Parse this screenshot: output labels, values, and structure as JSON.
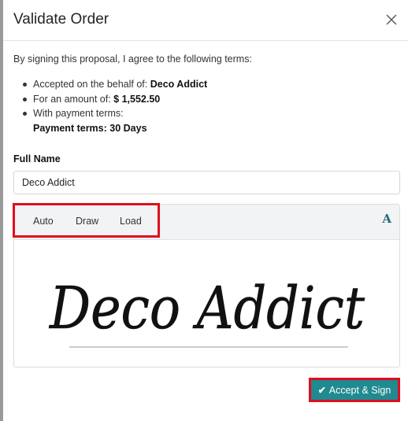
{
  "dialog": {
    "title": "Validate Order",
    "intro": "By signing this proposal, I agree to the following terms:",
    "terms": {
      "behalf_label": "Accepted on the behalf of: ",
      "behalf_value": "Deco Addict",
      "amount_label": "For an amount of: ",
      "amount_value": "$ 1,552.50",
      "payment_label": "With payment terms:",
      "payment_value": "Payment terms: 30 Days"
    },
    "full_name_label": "Full Name",
    "full_name_value": "Deco Addict",
    "signature": {
      "tabs": [
        "Auto",
        "Draw",
        "Load"
      ],
      "font_button": "A",
      "signature_text": "Deco Addict"
    },
    "accept_button": "Accept & Sign"
  },
  "colors": {
    "accent": "#1f8a8f",
    "highlight": "#e00d1f"
  }
}
